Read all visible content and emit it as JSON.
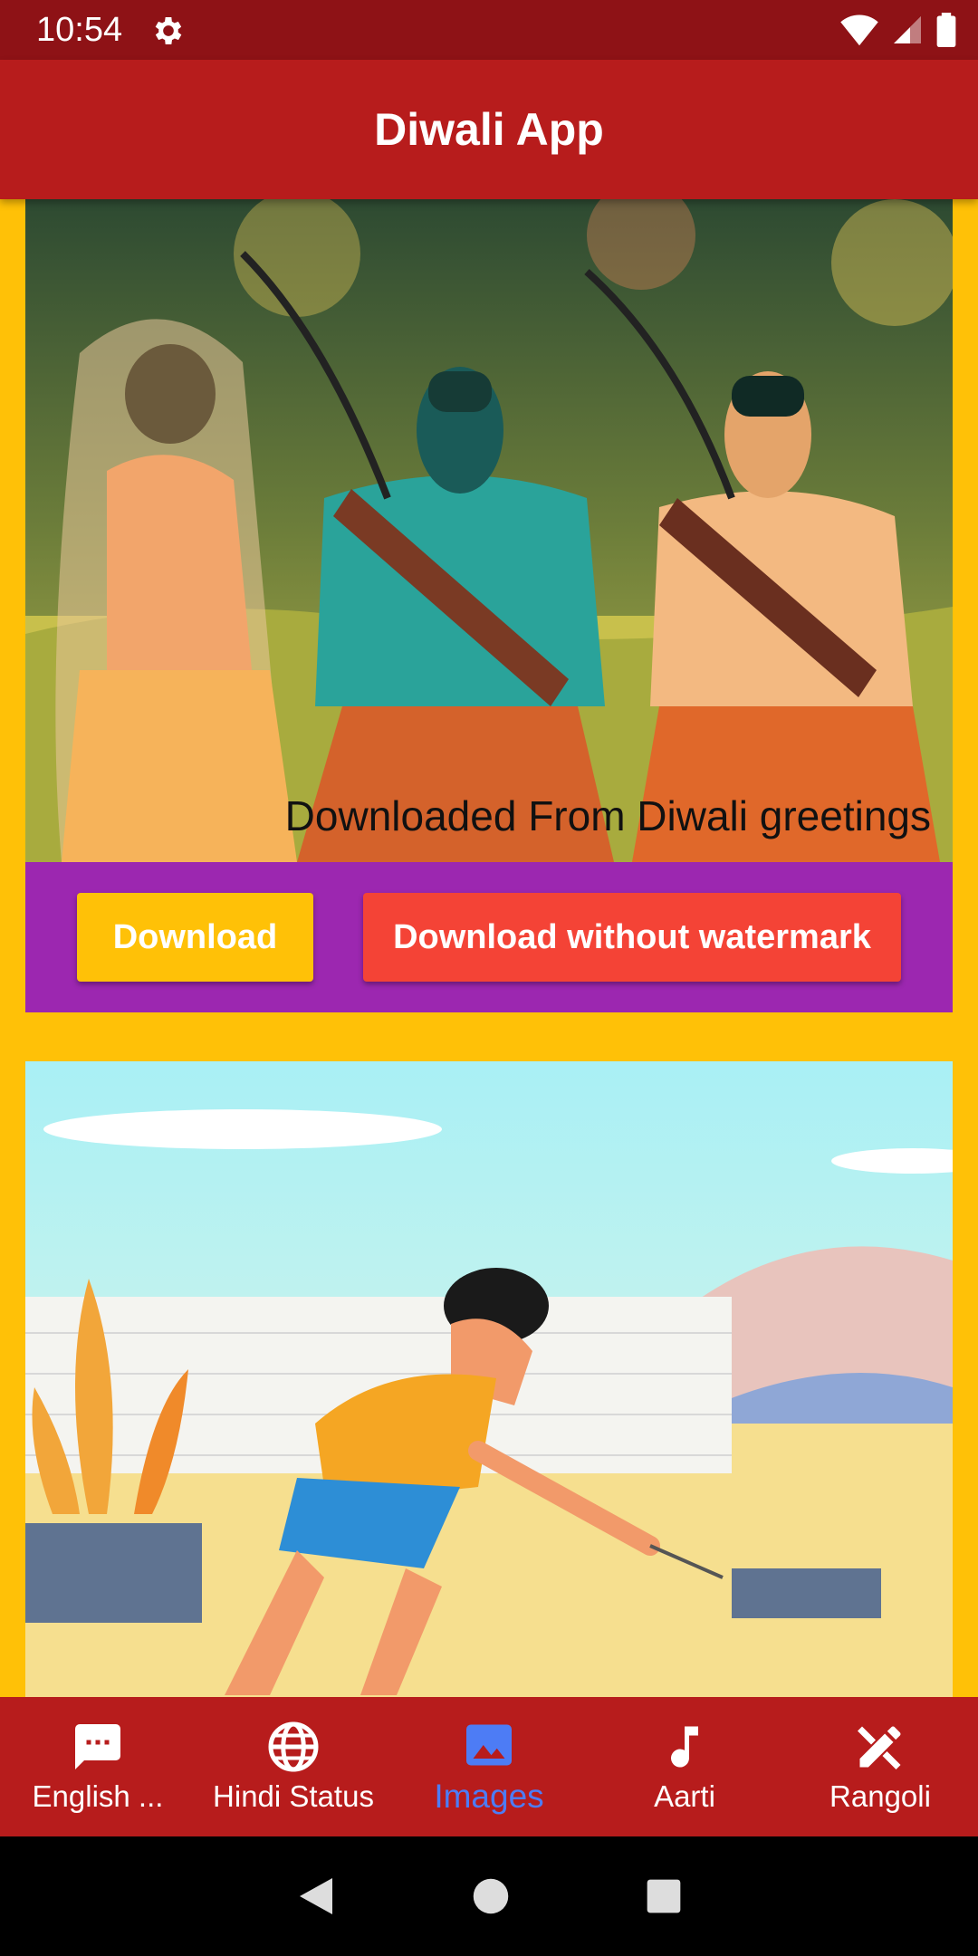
{
  "status": {
    "time": "10:54"
  },
  "app": {
    "title": "Diwali App"
  },
  "cards": [
    {
      "watermark": "Downloaded From Diwali greetings",
      "download_label": "Download",
      "download_nowm_label": "Download without watermark"
    }
  ],
  "nav": {
    "items": [
      {
        "label": "English ...",
        "icon": "message-icon"
      },
      {
        "label": "Hindi Status",
        "icon": "globe-icon"
      },
      {
        "label": "Images",
        "icon": "image-icon",
        "active": true
      },
      {
        "label": "Aarti",
        "icon": "music-note-icon"
      },
      {
        "label": "Rangoli",
        "icon": "design-tools-icon"
      }
    ]
  },
  "colors": {
    "status_bar": "#8e1216",
    "app_bar": "#b71c1c",
    "background": "#ffc107",
    "action_strip": "#9c27b0",
    "download_button": "#ffc107",
    "download_nowm_button": "#f44336",
    "active_nav": "#4d7cf5"
  }
}
